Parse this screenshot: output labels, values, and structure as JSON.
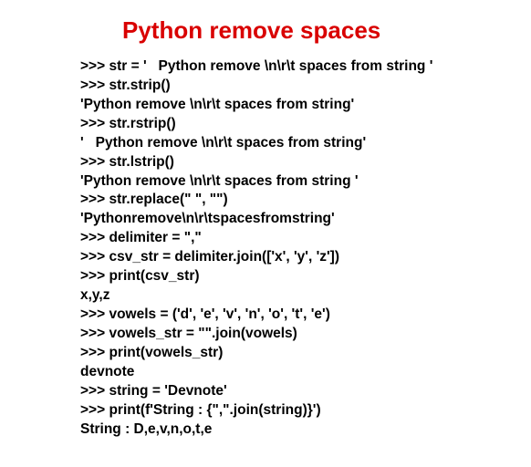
{
  "title": "Python remove spaces",
  "prompt": ">>> ",
  "lines": [
    {
      "is_input": true,
      "text": "str = '   Python remove \\n\\r\\t spaces from string '"
    },
    {
      "is_input": true,
      "text": "str.strip()"
    },
    {
      "is_input": false,
      "text": "'Python remove \\n\\r\\t spaces from string'"
    },
    {
      "is_input": true,
      "text": "str.rstrip()"
    },
    {
      "is_input": false,
      "text": "'   Python remove \\n\\r\\t spaces from string'"
    },
    {
      "is_input": true,
      "text": "str.lstrip()"
    },
    {
      "is_input": false,
      "text": "'Python remove \\n\\r\\t spaces from string '"
    },
    {
      "is_input": true,
      "text": "str.replace(\" \", \"\")"
    },
    {
      "is_input": false,
      "text": "'Pythonremove\\n\\r\\tspacesfromstring'"
    },
    {
      "is_input": true,
      "text": "delimiter = \",\""
    },
    {
      "is_input": true,
      "text": "csv_str = delimiter.join(['x', 'y', 'z'])"
    },
    {
      "is_input": true,
      "text": "print(csv_str)"
    },
    {
      "is_input": false,
      "text": "x,y,z"
    },
    {
      "is_input": true,
      "text": "vowels = ('d', 'e', 'v', 'n', 'o', 't', 'e')"
    },
    {
      "is_input": true,
      "text": "vowels_str = \"\".join(vowels)"
    },
    {
      "is_input": true,
      "text": "print(vowels_str)"
    },
    {
      "is_input": false,
      "text": "devnote"
    },
    {
      "is_input": true,
      "text": "string = 'Devnote'"
    },
    {
      "is_input": true,
      "text": "print(f'String : {\",\".join(string)}')"
    },
    {
      "is_input": false,
      "text": "String : D,e,v,n,o,t,e"
    }
  ]
}
